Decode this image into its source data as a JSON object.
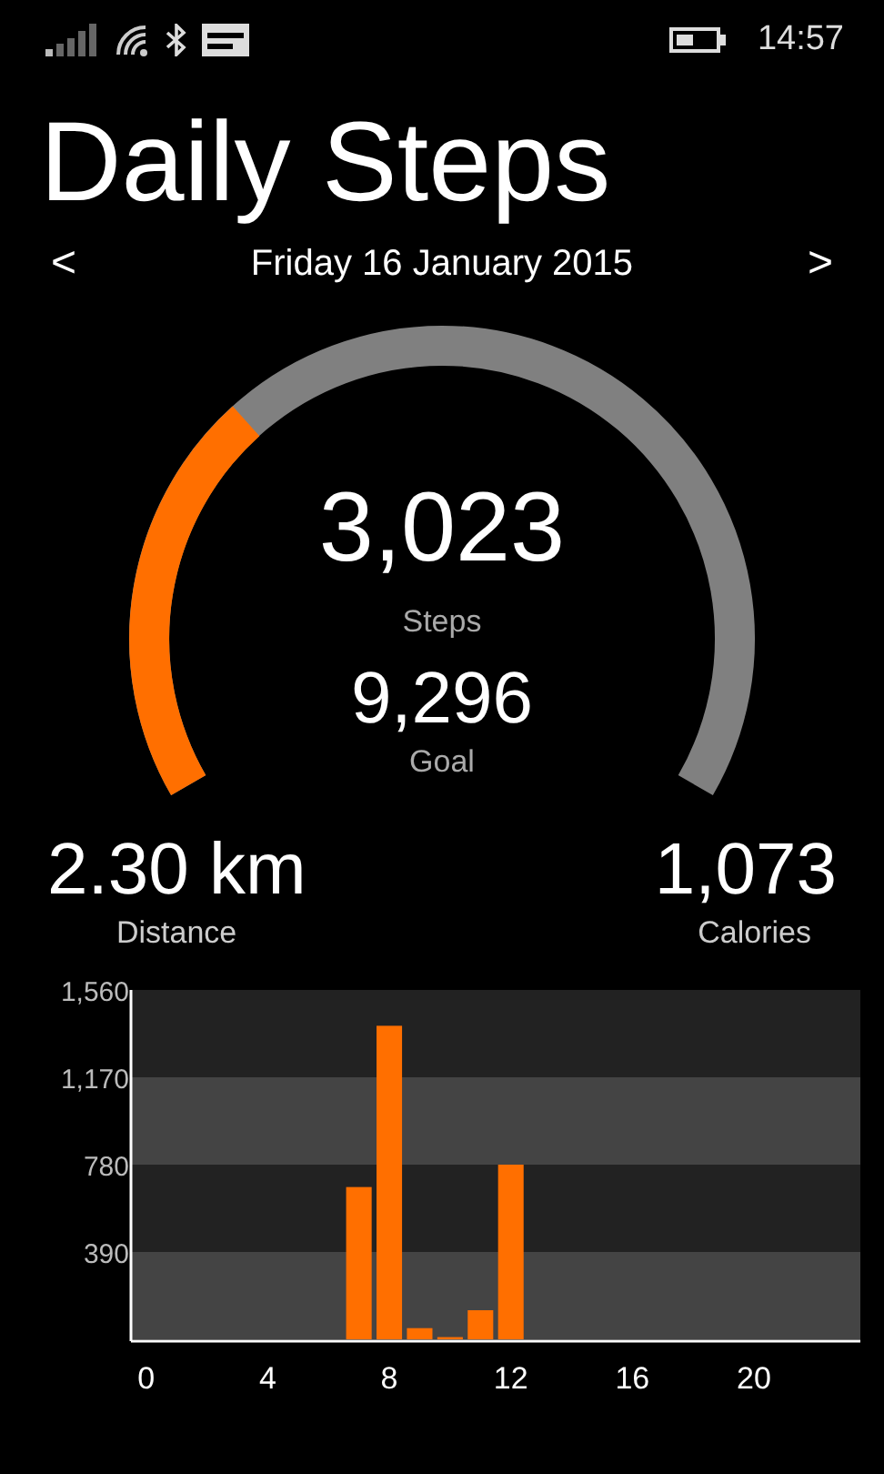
{
  "status_bar": {
    "time": "14:57"
  },
  "title": "Daily Steps",
  "date_nav": {
    "prev": "<",
    "date": "Friday 16 January 2015",
    "next": ">"
  },
  "gauge": {
    "steps": "3,023",
    "steps_label": "Steps",
    "goal": "9,296",
    "goal_label": "Goal"
  },
  "stats": [
    {
      "value": "2.30 km",
      "label": "Distance"
    },
    {
      "value": "1,073",
      "label": "Calories"
    }
  ],
  "chart_data": {
    "type": "bar",
    "x": [
      0,
      1,
      2,
      3,
      4,
      5,
      6,
      7,
      8,
      9,
      10,
      11,
      12,
      13,
      14,
      15,
      16,
      17,
      18,
      19,
      20,
      21,
      22,
      23
    ],
    "xlim": [
      -0.5,
      23.5
    ],
    "series": [
      {
        "color": "#ff6f00",
        "values": [
          0,
          0,
          0,
          0,
          0,
          0,
          0,
          680,
          1400,
          50,
          10,
          130,
          780,
          0,
          0,
          0,
          0,
          0,
          0,
          0,
          0,
          0,
          0,
          0
        ]
      }
    ],
    "ylim": [
      0,
      1560
    ],
    "yticks": [
      {
        "value": 390,
        "label": "390"
      },
      {
        "value": 780,
        "label": "780"
      },
      {
        "value": 1170,
        "label": "1,170"
      },
      {
        "value": 1560,
        "label": "1,560"
      }
    ],
    "xticks": [
      0,
      4,
      8,
      12,
      16,
      20
    ]
  }
}
